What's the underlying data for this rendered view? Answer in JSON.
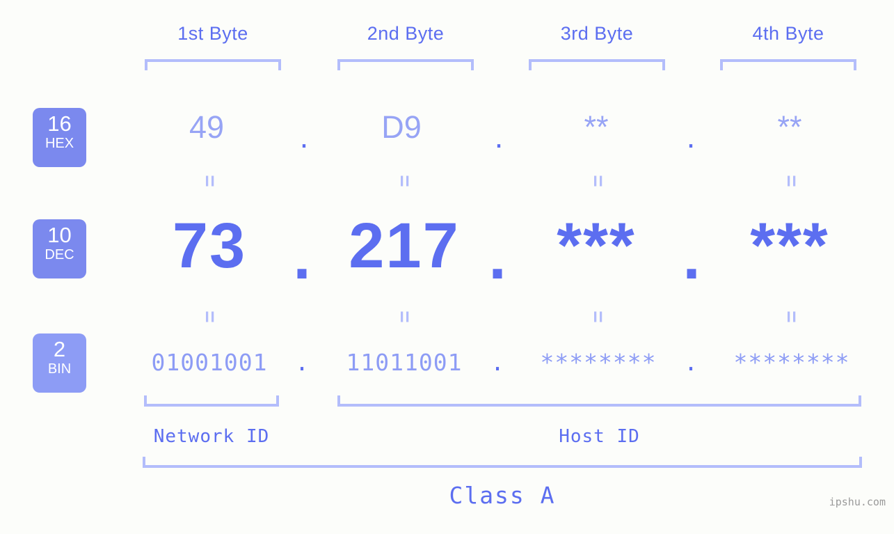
{
  "background_color": "#fcfdfa",
  "accent_color": "#5c6ef0",
  "accent_light_color": "#97a4f5",
  "bracket_color": "#b3bdfb",
  "byte_headers": [
    {
      "label": "1st Byte"
    },
    {
      "label": "2nd Byte"
    },
    {
      "label": "3rd Byte"
    },
    {
      "label": "4th Byte"
    }
  ],
  "bases": {
    "hex": {
      "number": "16",
      "name": "HEX",
      "badge_color": "#7b89ee"
    },
    "dec": {
      "number": "10",
      "name": "DEC",
      "badge_color": "#7b89ee"
    },
    "bin": {
      "number": "2",
      "name": "BIN",
      "badge_color": "#8d9cf5"
    }
  },
  "rows": {
    "hex": {
      "values": [
        "49",
        "D9",
        "**",
        "**"
      ],
      "separator": "."
    },
    "dec": {
      "values": [
        "73",
        "217",
        "***",
        "***"
      ],
      "separator": "."
    },
    "bin": {
      "values": [
        "01001001",
        "11011001",
        "********",
        "********"
      ],
      "separator": "."
    }
  },
  "connector": "=",
  "segments": {
    "network_id": "Network ID",
    "host_id": "Host ID"
  },
  "class_label": "Class A",
  "watermark": "ipshu.com"
}
